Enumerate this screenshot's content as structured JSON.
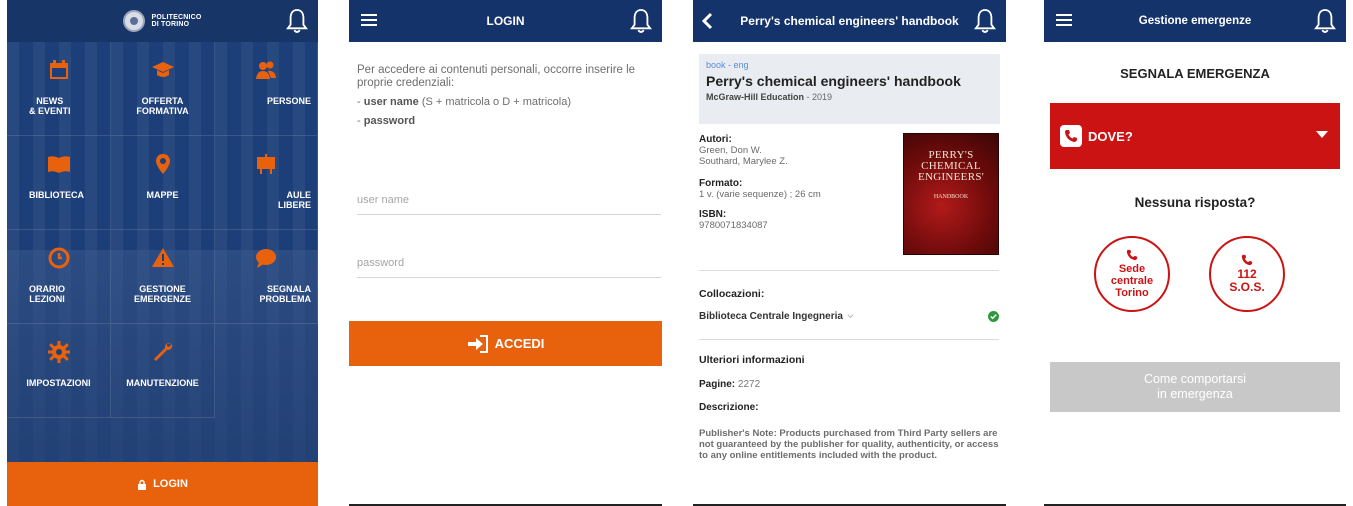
{
  "home": {
    "logo_text_line1": "POLITECNICO",
    "logo_text_line2": "DI TORINO",
    "tiles": [
      {
        "line1": "NEWS",
        "line2": "& EVENTI",
        "icon": "calendar-icon"
      },
      {
        "line1": "OFFERTA",
        "line2": "FORMATIVA",
        "icon": "graduation-cap-icon"
      },
      {
        "line1": "PERSONE",
        "line2": "",
        "icon": "people-icon"
      },
      {
        "line1": "BIBLIOTECA",
        "line2": "",
        "icon": "book-icon"
      },
      {
        "line1": "MAPPE",
        "line2": "",
        "icon": "map-pin-icon"
      },
      {
        "line1": "AULE",
        "line2": "LIBERE",
        "icon": "classroom-icon"
      },
      {
        "line1": "ORARIO",
        "line2": "LEZIONI",
        "icon": "clock-icon"
      },
      {
        "line1": "GESTIONE",
        "line2": "EMERGENZE",
        "icon": "warning-icon"
      },
      {
        "line1": "SEGNALA",
        "line2": "PROBLEMA",
        "icon": "chat-icon"
      },
      {
        "line1": "IMPOSTAZIONI",
        "line2": "",
        "icon": "gear-icon"
      },
      {
        "line1": "MANUTENZIONE",
        "line2": "",
        "icon": "wrench-icon"
      }
    ],
    "login_label": "LOGIN"
  },
  "login": {
    "title": "LOGIN",
    "intro": "Per accedere ai contenuti personali, occorre inserire le proprie credenziali:",
    "req1_bold": "user name",
    "req1_rest": " (S + matricola o D + matricola)",
    "req2_bold": "password",
    "username_placeholder": "user name",
    "password_placeholder": "password",
    "submit_label": "ACCEDI"
  },
  "book": {
    "header_title": "Perry's chemical engineers' handbook",
    "tag": "book - eng",
    "title": "Perry's chemical engineers' handbook",
    "publisher": "McGraw-Hill Education",
    "year": " - 2019",
    "authors_label": "Autori:",
    "authors": [
      "Green, Don W.",
      "Southard, Marylee Z."
    ],
    "format_label": "Formato:",
    "format": "1 v. (varie sequenze) ; 26 cm",
    "isbn_label": "ISBN:",
    "isbn": "9780071834087",
    "cover_title_lines": [
      "PERRY'S",
      "CHEMICAL",
      "ENGINEERS'"
    ],
    "cover_subtitle": "HANDBOOK",
    "locations_label": "Collocazioni:",
    "location": "Biblioteca Centrale Ingegneria",
    "more_label": "Ulteriori informazioni",
    "pages_label": "Pagine:",
    "pages": "2272",
    "description_label": "Descrizione:",
    "description": "Publisher's Note: Products purchased from Third Party sellers are not guaranteed by the publisher for quality, authenticity, or access to any online entitlements included with the product."
  },
  "emergency": {
    "title": "Gestione emergenze",
    "heading": "SEGNALA EMERGENZA",
    "where_label": "DOVE?",
    "no_answer": "Nessuna risposta?",
    "call1": [
      "Sede",
      "centrale",
      "Torino"
    ],
    "call2": [
      "112",
      "S.O.S."
    ],
    "behaviour_line1": "Come comportarsi",
    "behaviour_line2": "in emergenza"
  },
  "colors": {
    "blue": "#15336b",
    "orange": "#e8620e",
    "red": "#cc1313",
    "grey_button": "#c8c8c8"
  }
}
